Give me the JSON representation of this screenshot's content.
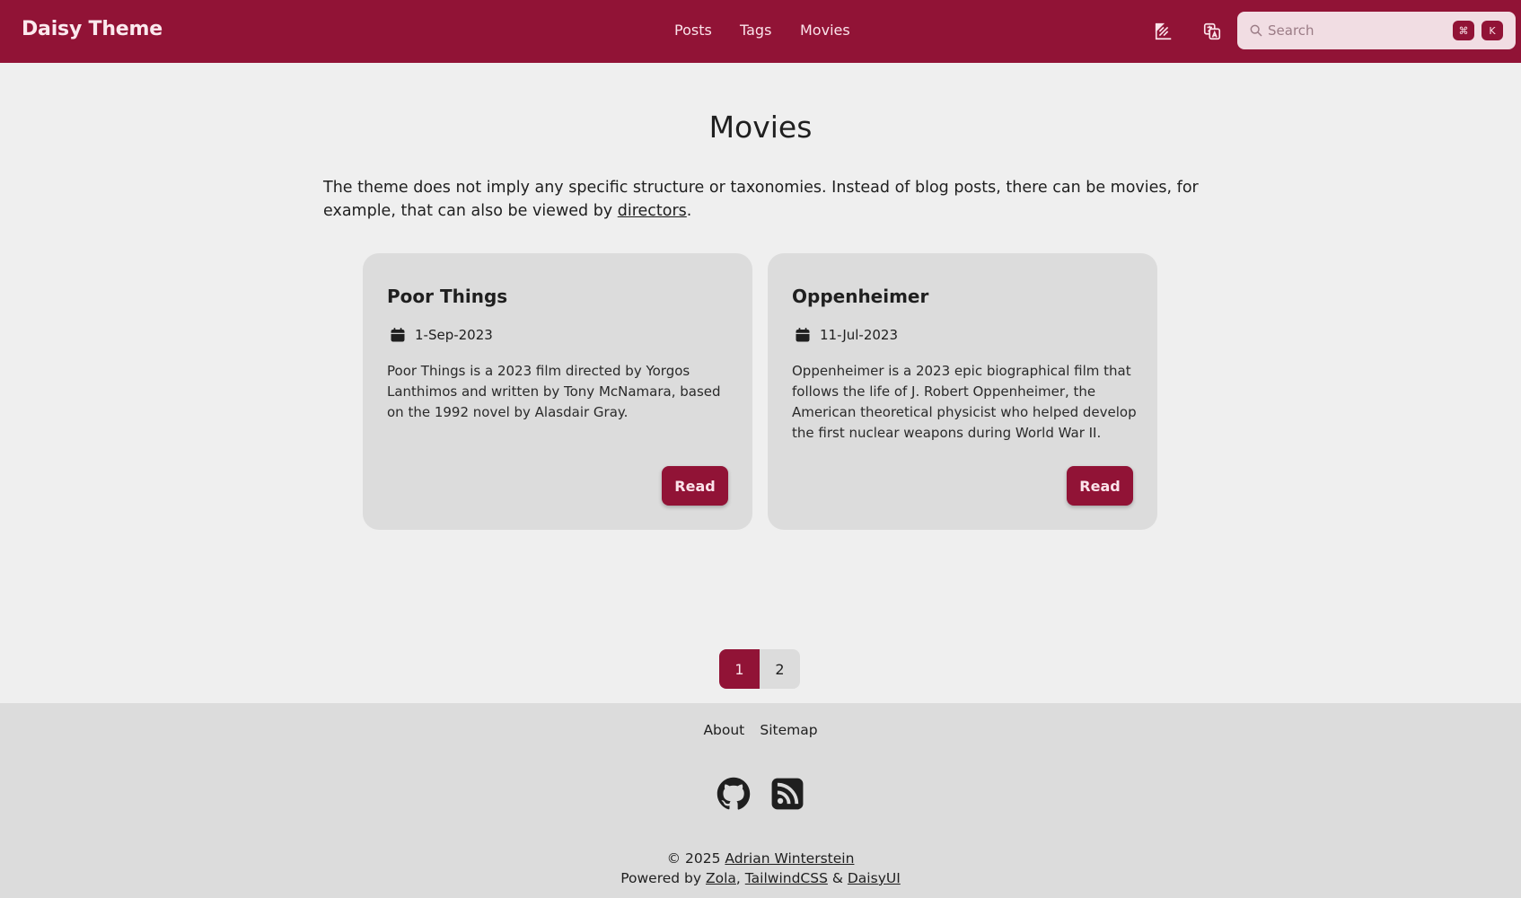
{
  "navbar": {
    "brand": "Daisy Theme",
    "links": [
      "Posts",
      "Tags",
      "Movies"
    ],
    "theme_icon": "theme-toggle-icon",
    "language_icon": "language-icon",
    "search": {
      "placeholder": "Search",
      "shortcut_mod": "⌘",
      "shortcut_key": "K"
    },
    "brand_color": "#911336"
  },
  "main": {
    "title": "Movies",
    "intro_text": "The theme does not imply any specific structure or taxonomies. Instead of blog posts, there can be movies, for example, that can also be viewed by ",
    "intro_link": "directors",
    "intro_end": ".",
    "cards": [
      {
        "title": "Poor Things",
        "date": "1-Sep-2023",
        "description": "Poor Things is a 2023 film directed by Yorgos Lanthimos and written by Tony McNamara, based on the 1992 novel by Alasdair Gray.",
        "button": "Read"
      },
      {
        "title": "Oppenheimer",
        "date": "11-Jul-2023",
        "description": "Oppenheimer is a 2023 epic biographical film that follows the life of J. Robert Oppenheimer, the American theoretical physicist who helped develop the first nuclear weapons during World War II.",
        "button": "Read"
      }
    ],
    "pagination": {
      "pages": [
        "1",
        "2"
      ],
      "current": "1"
    }
  },
  "footer": {
    "links": [
      "About",
      "Sitemap"
    ],
    "social_icons": [
      "github-icon",
      "rss-icon"
    ],
    "copyright_prefix": "© 2025 ",
    "author": "Adrian Winterstein",
    "powered_prefix": "Powered by ",
    "powered_zola": "Zola",
    "powered_tailwind": "TailwindCSS",
    "powered_amp": " & ",
    "powered_daisy": "DaisyUI",
    "comma": ", "
  }
}
